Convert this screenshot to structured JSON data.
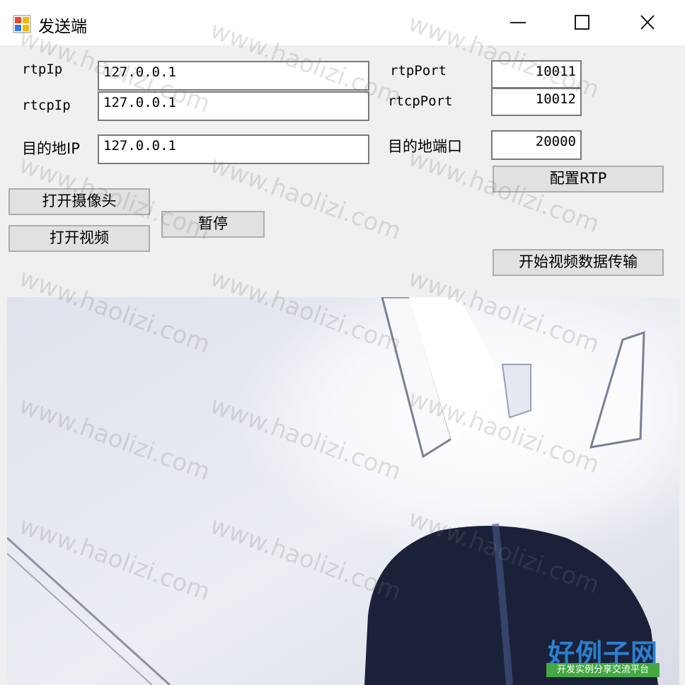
{
  "window": {
    "title": "发送端",
    "icon": "app-icon",
    "controls": {
      "minimize": "—",
      "maximize": "☐",
      "close": "✕"
    }
  },
  "form": {
    "rtp_ip_label": "rtpIp",
    "rtp_ip_value": "127.0.0.1",
    "rtcp_ip_label": "rtcpIp",
    "rtcp_ip_value": "127.0.0.1",
    "dest_ip_label": "目的地IP",
    "dest_ip_value": "127.0.0.1",
    "rtp_port_label": "rtpPort",
    "rtp_port_value": "10011",
    "rtcp_port_label": "rtcpPort",
    "rtcp_port_value": "10012",
    "dest_port_label": "目的地端口",
    "dest_port_value": "20000"
  },
  "buttons": {
    "config_rtp": "配置RTP",
    "open_camera": "打开摄像头",
    "open_video": "打开视频",
    "pause": "暂停",
    "start_transfer": "开始视频数据传输"
  },
  "watermark": {
    "text": "www.haolizi.com",
    "brand_name": "好例子网",
    "brand_slogan": "开发实例分享交流平台"
  },
  "colors": {
    "window_bg": "#f0f0f0",
    "titlebar_bg": "#ffffff",
    "button_bg": "#e1e1e1",
    "brand_blue": "#2a7fcf",
    "brand_green": "#45a845"
  }
}
